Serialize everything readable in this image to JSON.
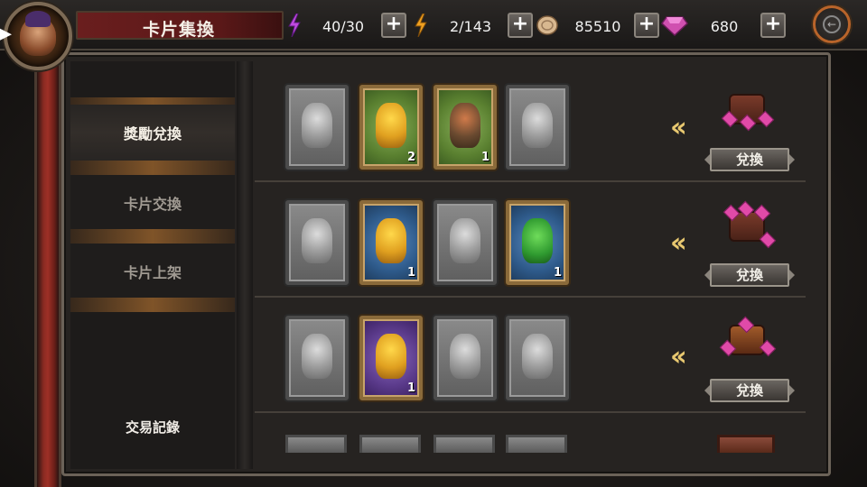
{
  "header": {
    "title": "卡片集換",
    "stamina": "40/30",
    "energy": "2/143",
    "coins": "85510",
    "gems": "680",
    "plus": "+"
  },
  "sidebar": {
    "items": [
      {
        "label": "獎勵兌換",
        "active": true
      },
      {
        "label": "卡片交換",
        "active": false
      },
      {
        "label": "卡片上架",
        "active": false
      }
    ],
    "history": "交易記錄"
  },
  "exchange_rows": [
    {
      "cards": [
        {
          "style": "gray",
          "count": ""
        },
        {
          "style": "green",
          "count": "2"
        },
        {
          "style": "green",
          "count": "1"
        },
        {
          "style": "gray",
          "count": ""
        }
      ],
      "reward_icon": "backpack-gems-icon",
      "button": "兌換"
    },
    {
      "cards": [
        {
          "style": "gray",
          "count": ""
        },
        {
          "style": "blue",
          "count": "1"
        },
        {
          "style": "gray",
          "count": ""
        },
        {
          "style": "blue",
          "count": "1"
        }
      ],
      "reward_icon": "gem-chest-icon",
      "button": "兌換"
    },
    {
      "cards": [
        {
          "style": "gray",
          "count": ""
        },
        {
          "style": "purple",
          "count": "1"
        },
        {
          "style": "gray",
          "count": ""
        },
        {
          "style": "gray",
          "count": ""
        }
      ],
      "reward_icon": "treasure-chest-icon",
      "button": "兌換"
    }
  ],
  "icons": {
    "stamina": "lightning-purple-icon",
    "energy": "lightning-orange-icon",
    "coins": "coin-icon",
    "gems": "diamond-icon",
    "home": "home-icon",
    "arrows": "double-chevron-left-icon"
  },
  "colors": {
    "accent_gold": "#e8c870",
    "title_red": "#6a1e1e",
    "stamina": "#c04adf",
    "energy": "#f0a020",
    "gem": "#e04aa8"
  }
}
